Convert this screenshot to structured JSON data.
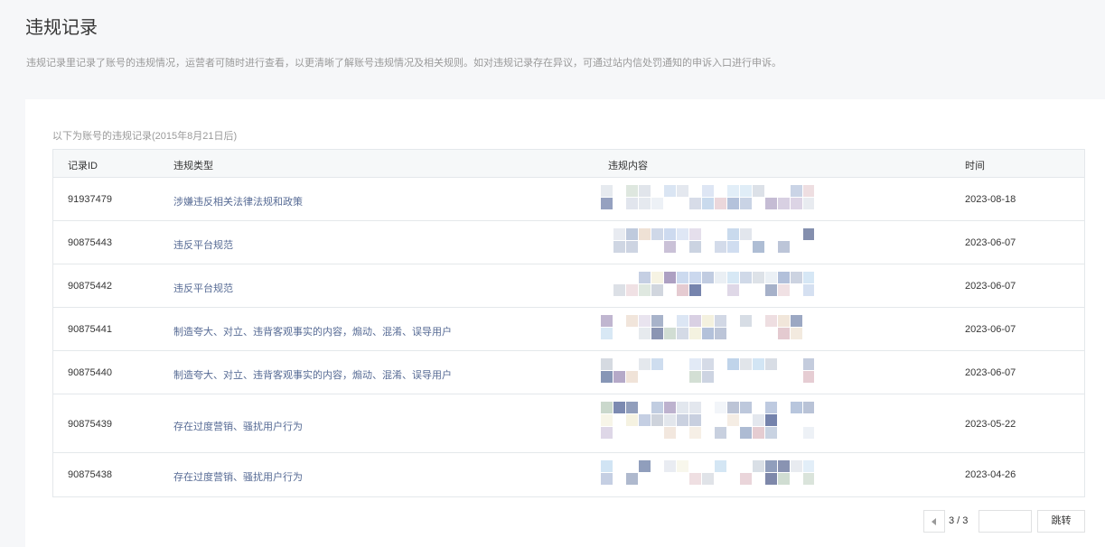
{
  "header": {
    "title": "违规记录",
    "description": "违规记录里记录了账号的违规情况，运营者可随时进行查看，以更清晰了解账号违规情况及相关规则。如对违规记录存在异议，可通过站内信处罚通知的申诉入口进行申诉。"
  },
  "panel": {
    "subtitle": "以下为账号的违规记录(2015年8月21日后)"
  },
  "table": {
    "columns": [
      "记录ID",
      "违规类型",
      "违规内容",
      "时间"
    ],
    "rows": [
      {
        "id": "91937479",
        "type": "涉嫌违反相关法律法规和政策",
        "time": "2023-08-18"
      },
      {
        "id": "90875443",
        "type": "违反平台规范",
        "time": "2023-06-07"
      },
      {
        "id": "90875442",
        "type": "违反平台规范",
        "time": "2023-06-07"
      },
      {
        "id": "90875441",
        "type": "制造夸大、对立、违背客观事实的内容，煽动、混淆、误导用户",
        "time": "2023-06-07"
      },
      {
        "id": "90875440",
        "type": "制造夸大、对立、违背客观事实的内容，煽动、混淆、误导用户",
        "time": "2023-06-07"
      },
      {
        "id": "90875439",
        "type": "存在过度营销、骚扰用户行为",
        "time": "2023-05-22"
      },
      {
        "id": "90875438",
        "type": "存在过度营销、骚扰用户行为",
        "time": "2023-04-26"
      }
    ]
  },
  "pagination": {
    "current": "3 / 3",
    "input_value": "",
    "jump_label": "跳转"
  },
  "colors": {
    "link": "#576b95",
    "border": "#e4e8eb",
    "muted": "#9a9a9a"
  }
}
